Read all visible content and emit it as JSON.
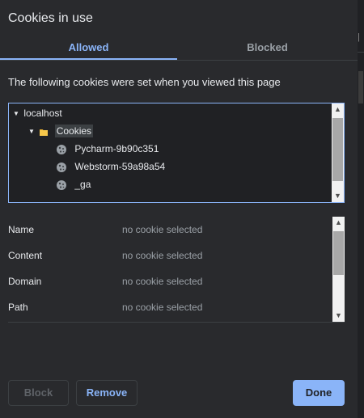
{
  "dialog": {
    "title": "Cookies in use",
    "tabs": [
      {
        "label": "Allowed",
        "active": true
      },
      {
        "label": "Blocked",
        "active": false
      }
    ],
    "intro_text": "The following cookies were set when you viewed this page"
  },
  "tree": {
    "site": {
      "label": "localhost",
      "expanded": true
    },
    "folder": {
      "label": "Cookies",
      "expanded": true,
      "selected": true,
      "icon": "folder-icon"
    },
    "cookies": [
      {
        "label": "Pycharm-9b90c351",
        "icon": "cookie-icon"
      },
      {
        "label": "Webstorm-59a98a54",
        "icon": "cookie-icon"
      },
      {
        "label": "_ga",
        "icon": "cookie-icon"
      }
    ]
  },
  "details": {
    "rows": [
      {
        "label": "Name",
        "value": "no cookie selected"
      },
      {
        "label": "Content",
        "value": "no cookie selected"
      },
      {
        "label": "Domain",
        "value": "no cookie selected"
      },
      {
        "label": "Path",
        "value": "no cookie selected"
      }
    ]
  },
  "buttons": {
    "block": {
      "label": "Block",
      "enabled": false
    },
    "remove": {
      "label": "Remove",
      "enabled": true
    },
    "done": {
      "label": "Done",
      "enabled": true
    }
  },
  "colors": {
    "accent": "#8ab4f8",
    "dialog_bg": "#292a2d",
    "text": "#e8eaed",
    "muted": "#9aa0a6",
    "folder": "#f6c74a"
  }
}
